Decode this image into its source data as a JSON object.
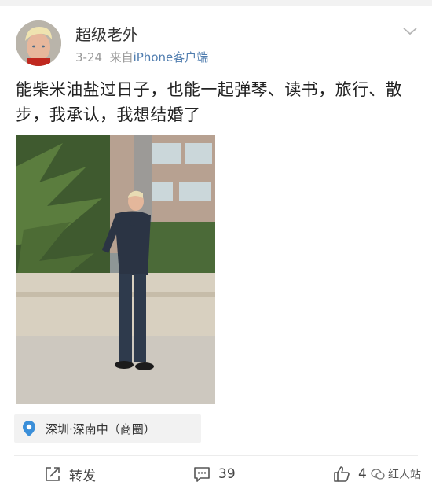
{
  "post": {
    "username": "超级老外",
    "date": "3-24",
    "source_prefix": "来自",
    "source": "iPhone客户端",
    "text": "能柴米油盐过日子，也能一起弹琴、读书，旅行、散步，我承认，我想结婚了",
    "location": "深圳·深南中（商圈）"
  },
  "actions": {
    "repost_label": "转发",
    "comment_count": "39",
    "like_count": "4"
  },
  "watermark": {
    "text": "红人站"
  },
  "icons": {
    "dropdown": "chevron-down-icon",
    "location": "location-pin-icon",
    "repost": "repost-icon",
    "comment": "comment-icon",
    "like": "thumbs-up-icon"
  },
  "colors": {
    "source_link": "#507daf",
    "location_pin": "#3b8fd9",
    "meta_gray": "#999999"
  }
}
